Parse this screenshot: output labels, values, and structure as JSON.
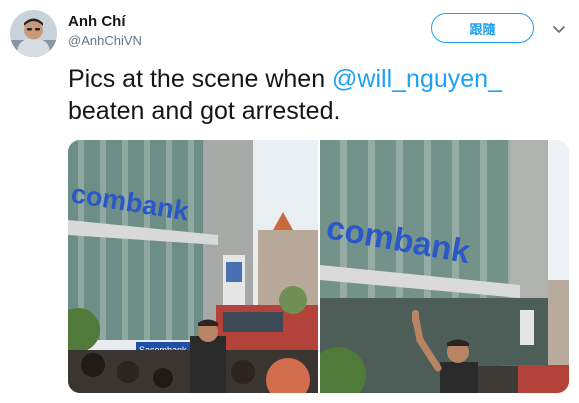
{
  "user": {
    "display_name": "Anh Chí",
    "handle": "@AnhChiVN",
    "avatar_icon": "profile-photo"
  },
  "follow_button": {
    "label": "跟隨"
  },
  "menu": {
    "icon": "chevron-down-icon"
  },
  "tweet": {
    "text_before": "Pics at the scene when ",
    "mention": "@will_nguyen_",
    "text_after": " beaten and got arrested."
  },
  "photos": [
    {
      "sign_text": "combank",
      "small_sign": "Sacombank"
    },
    {
      "sign_text": "combank"
    }
  ],
  "colors": {
    "accent": "#1da1f2",
    "text": "#14171a",
    "muted": "#657786"
  }
}
